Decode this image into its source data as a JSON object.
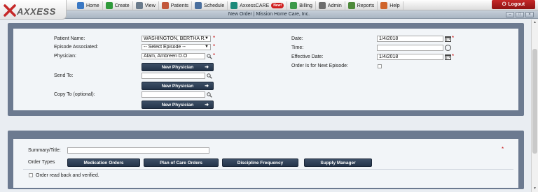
{
  "app": {
    "logo_text": "AXXESS",
    "nav": [
      {
        "label": "Home",
        "icon": "home-icon",
        "color": "#3a78c4"
      },
      {
        "label": "Create",
        "icon": "plus-icon",
        "color": "#2f9a3a"
      },
      {
        "label": "View",
        "icon": "magnifier-icon",
        "color": "#6a7b8c"
      },
      {
        "label": "Patients",
        "icon": "patients-icon",
        "color": "#c2563a"
      },
      {
        "label": "Schedule",
        "icon": "calendar-icon",
        "color": "#4a6f9e"
      },
      {
        "label": "AxxessCARE",
        "icon": "heart-icon",
        "color": "#1c8a7a",
        "badge": "New!"
      },
      {
        "label": "Billing",
        "icon": "billing-icon",
        "color": "#3c9a4a"
      },
      {
        "label": "Admin",
        "icon": "gear-icon",
        "color": "#6d6d6d"
      },
      {
        "label": "Reports",
        "icon": "reports-icon",
        "color": "#4e8a3a"
      },
      {
        "label": "Help",
        "icon": "help-icon",
        "color": "#d0652c"
      }
    ],
    "logout_label": "Logout"
  },
  "window": {
    "title": "New Order | Mission Home Care, Inc.",
    "controls": [
      "–",
      "□",
      "×"
    ]
  },
  "form": {
    "patient_name_label": "Patient Name:",
    "patient_name_value": "WASHINGTON, BERTHA R.",
    "episode_label": "Episode Associated:",
    "episode_value": "-- Select Episode --",
    "physician_label": "Physician:",
    "physician_value": "Alam, Ambreen D.O",
    "new_physician_label": "New Physician",
    "send_to_label": "Send To:",
    "send_to_value": "",
    "copy_to_label": "Copy To (optional):",
    "copy_to_value": "",
    "date_label": "Date:",
    "date_value": "1/4/2018",
    "time_label": "Time:",
    "time_value": "",
    "effective_date_label": "Effective Date:",
    "effective_date_value": "1/4/2018",
    "next_episode_label": "Order Is for Next Episode:",
    "required_mark": "*"
  },
  "summary": {
    "summary_label": "Summary/Title:",
    "summary_value": "",
    "order_types_label": "Order Types",
    "order_type_buttons": [
      "Medication Orders",
      "Plan of Care Orders",
      "Discipline Frequency",
      "Supply Manager"
    ],
    "read_back_label": "Order read back and verified."
  }
}
